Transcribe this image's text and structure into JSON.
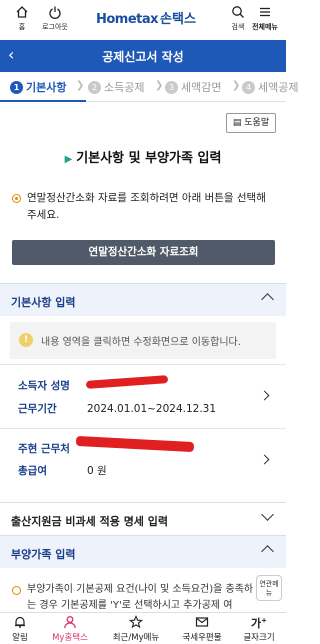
{
  "header": {
    "home_label": "홈",
    "login_label": "로그아웃",
    "logo_home": "Hometax",
    "logo_son": "손택스",
    "search_label": "검색",
    "menu_label": "전체메뉴"
  },
  "title_bar": {
    "title": "공제신고서 작성"
  },
  "steps": [
    {
      "num": "1",
      "label": "기본사항"
    },
    {
      "num": "2",
      "label": "소득공제"
    },
    {
      "num": "3",
      "label": "세액감면"
    },
    {
      "num": "4",
      "label": "세액공제"
    }
  ],
  "help_label": "도움말",
  "section_title": "기본사항 및 부양가족 입력",
  "notice_text": "연말정산간소화 자료를 조회하려면 아래 버튼을 선택해 주세요.",
  "query_button": "연말정산간소화 자료조회",
  "basic": {
    "title": "기본사항 입력",
    "info": "내용 영역을 클릭하면 수정화면으로 이동합니다.",
    "card1": {
      "name_key": "소득자 성명",
      "period_key": "근무기간",
      "period_value": "2024.01.01~2024.12.31"
    },
    "card2": {
      "company_key": "주현 근무처",
      "pay_key": "총급여",
      "pay_value": "0 원"
    }
  },
  "childbirth_section": "출산지원금 비과세 적용 명세 입력",
  "dependents": {
    "title": "부양가족 입력",
    "text": "부양가족이 기본공제 요건(나이 및 소득요건)을 충족하는 경우 기본공제를 'Y'로 선택하시고 추가공제 여"
  },
  "float_button": "연관메뉴",
  "bottom_nav": [
    {
      "label": "알림"
    },
    {
      "label": "My홈택스"
    },
    {
      "label": "최근/My메뉴"
    },
    {
      "label": "국세우편물"
    },
    {
      "label": "글자크기"
    }
  ],
  "colors": {
    "primary": "#1e59b8",
    "accent": "#d9356a",
    "button": "#505a68"
  }
}
